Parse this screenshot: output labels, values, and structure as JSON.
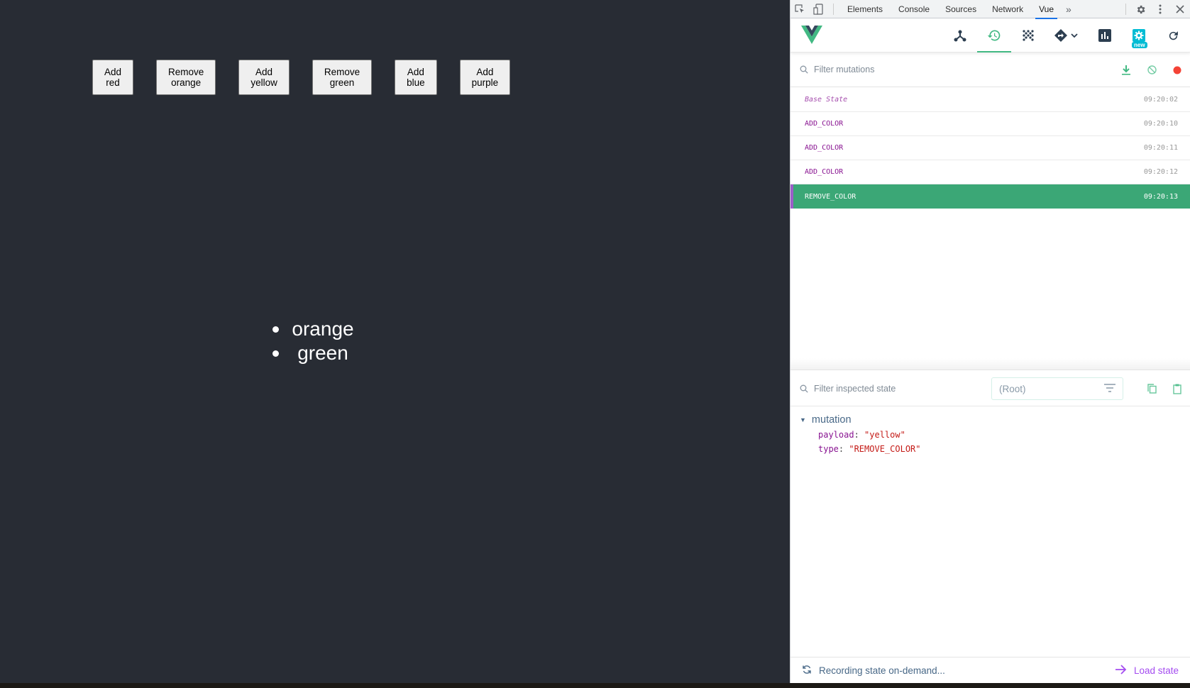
{
  "app": {
    "buttons": [
      {
        "line1": "Add",
        "line2": "red"
      },
      {
        "line1": "Remove",
        "line2": "orange"
      },
      {
        "line1": "Add",
        "line2": "yellow"
      },
      {
        "line1": "Remove",
        "line2": "green"
      },
      {
        "line1": "Add",
        "line2": "blue"
      },
      {
        "line1": "Add",
        "line2": "purple"
      }
    ],
    "colors": [
      "orange",
      "green"
    ]
  },
  "devtools": {
    "tabs": [
      "Elements",
      "Console",
      "Sources",
      "Network",
      "Vue"
    ],
    "active_tab": "Vue",
    "more_tabs": "»",
    "vue_toolbar": {
      "icons": [
        "components-icon",
        "vuex-history-icon",
        "events-icon",
        "routing-icon",
        "performance-icon",
        "settings-icon",
        "refresh-icon"
      ],
      "active": "vuex-history-icon",
      "new_badge": "new"
    },
    "mutations": {
      "filter_placeholder": "Filter mutations",
      "items": [
        {
          "name": "Base State",
          "time": "09:20:02",
          "base": true
        },
        {
          "name": "ADD_COLOR",
          "time": "09:20:10"
        },
        {
          "name": "ADD_COLOR",
          "time": "09:20:11"
        },
        {
          "name": "ADD_COLOR",
          "time": "09:20:12"
        },
        {
          "name": "REMOVE_COLOR",
          "time": "09:20:13",
          "selected": true
        }
      ]
    },
    "state": {
      "filter_placeholder": "Filter inspected state",
      "root_select": "(Root)",
      "section": "mutation",
      "fields": [
        {
          "key": "payload",
          "value": "\"yellow\""
        },
        {
          "key": "type",
          "value": "\"REMOVE_COLOR\""
        }
      ]
    },
    "footer": {
      "status": "Recording state on-demand...",
      "load_state": "Load state"
    }
  },
  "colors": {
    "app_bg": "#282c34",
    "vue_green": "#42b983",
    "selected_row": "#3ba776",
    "selected_accent": "#9a5ec8",
    "record_red": "#f44336",
    "load_state": "#a44cf0"
  }
}
